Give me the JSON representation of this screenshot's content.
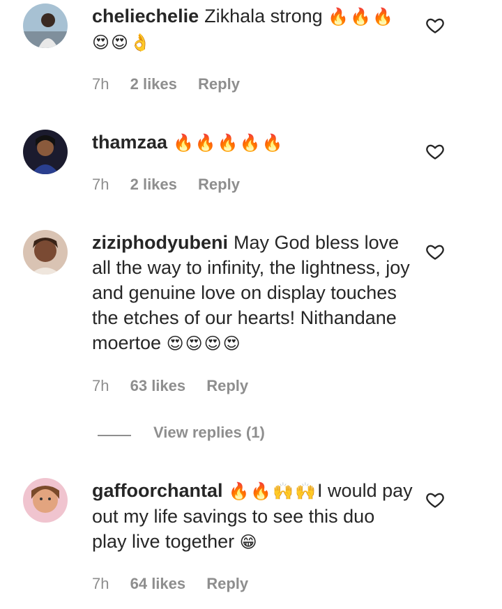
{
  "comments": [
    {
      "username": "cheliechelie",
      "text": "Zikhala strong",
      "emoji": "🔥🔥🔥😍😍👌",
      "time": "7h",
      "likes": "2 likes",
      "reply": "Reply",
      "avatar_colors": [
        "#9bb7c9",
        "#2b2b2b"
      ]
    },
    {
      "username": "thamzaa",
      "text": "",
      "emoji": "🔥🔥🔥🔥🔥",
      "time": "7h",
      "likes": "2 likes",
      "reply": "Reply",
      "avatar_colors": [
        "#2a3f8f",
        "#111111"
      ]
    },
    {
      "username": "ziziphodyubeni",
      "text": "May God bless love all the way to infinity, the lightness, joy and genuine love on display touches the etches of our hearts! Nithandane moertoe",
      "emoji": "😍😍😍😍",
      "time": "7h",
      "likes": "63 likes",
      "reply": "Reply",
      "avatar_colors": [
        "#c9a48a",
        "#5a3a2a"
      ]
    },
    {
      "username": "gaffoorchantal",
      "text": "I would pay out my life savings to see this duo play live together",
      "emoji_before": "🔥🔥🙌🙌",
      "emoji": "😁",
      "time": "7h",
      "likes": "64 likes",
      "reply": "Reply",
      "avatar_colors": [
        "#e9a0b6",
        "#b8845a"
      ]
    }
  ],
  "view_replies": "View replies (1)",
  "colors": {
    "text": "#262626",
    "meta": "#8e8e8e",
    "background": "#ffffff"
  },
  "icons": {
    "like": "heart-outline-icon"
  }
}
